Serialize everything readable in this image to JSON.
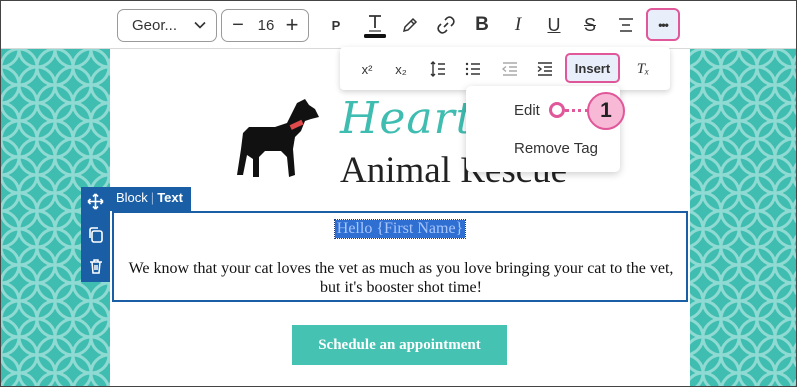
{
  "toolbar": {
    "font_family": "Geor...",
    "font_size": "16",
    "minus": "−",
    "plus": "+",
    "paragraph_label": "P",
    "bold_label": "B",
    "italic_label": "I",
    "underline_label": "U",
    "strike_label": "S",
    "more_label": "•••"
  },
  "toolbar2": {
    "superscript_label": "x²",
    "subscript_label": "x₂",
    "insert_label": "Insert",
    "clear_format_label": "Tₓ"
  },
  "dropdown": {
    "items": [
      {
        "label": "Edit"
      },
      {
        "label": "Remove Tag"
      }
    ]
  },
  "callout": {
    "number": "1"
  },
  "logo": {
    "script_text": "Hearts &",
    "sub_text": "Animal Rescue"
  },
  "block": {
    "label": "Block",
    "type": "Text"
  },
  "content": {
    "greeting": "Hello {First Name}",
    "body": "We know that your cat loves the vet as much as you love bringing your cat to the vet, but it's booster shot time!",
    "cta_label": "Schedule an appointment"
  },
  "colors": {
    "accent_pink": "#e0579a",
    "teal": "#3fbdb0",
    "block_blue": "#1a5fa6",
    "selection_blue": "#2f6fd1"
  }
}
